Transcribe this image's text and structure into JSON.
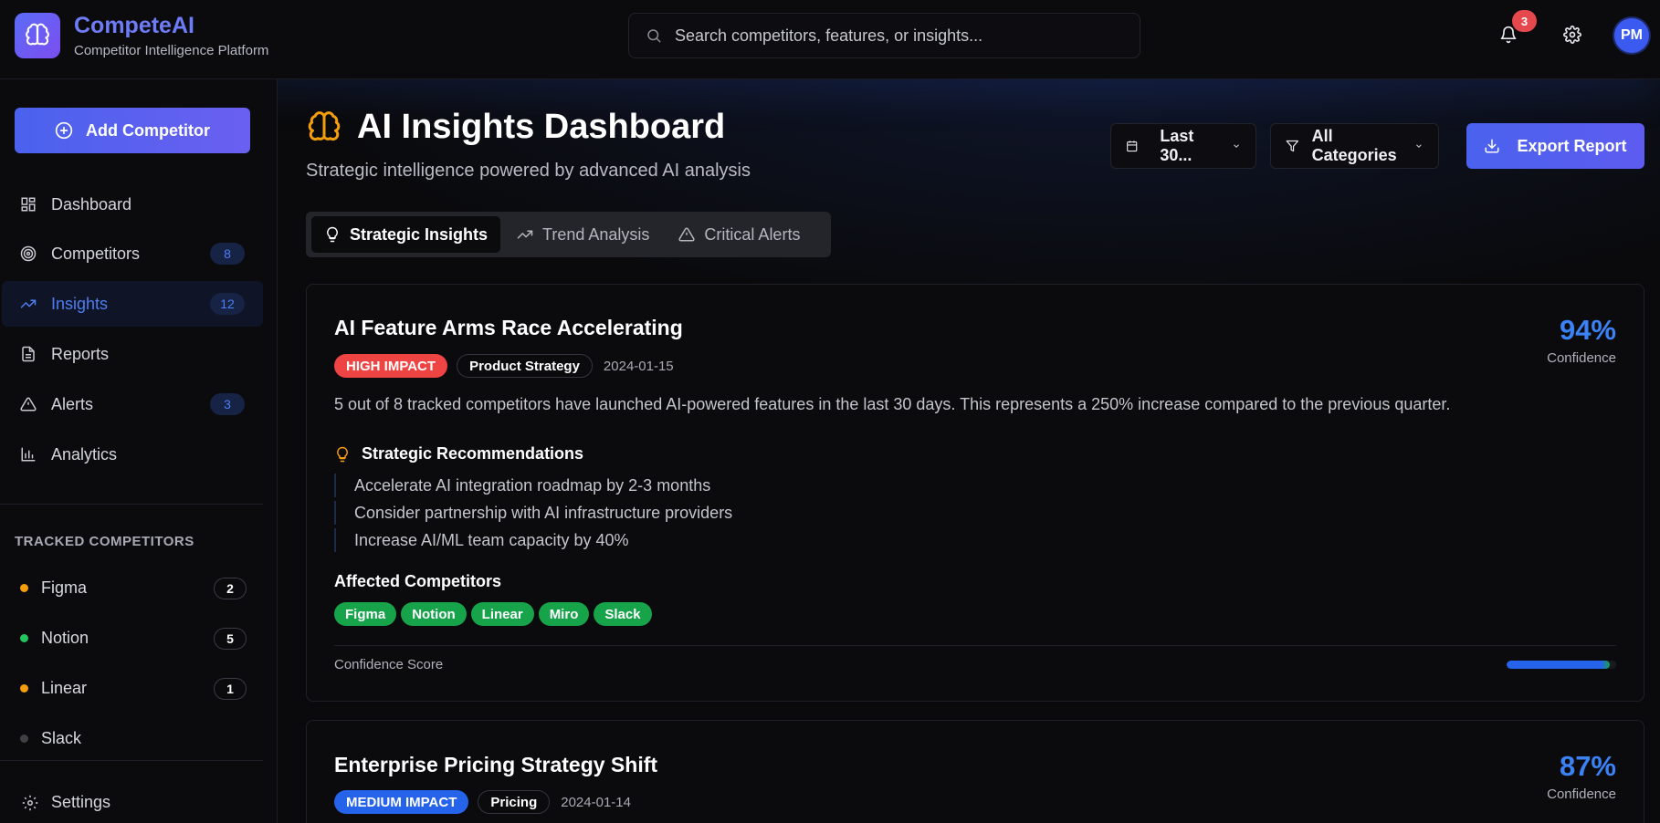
{
  "app": {
    "name": "CompeteAI",
    "tagline": "Competitor Intelligence Platform",
    "brand_color": "#6e7cf7"
  },
  "header": {
    "search_placeholder": "Search competitors, features, or insights...",
    "notification_count": "3",
    "avatar_initials": "PM"
  },
  "sidebar": {
    "add_button_label": "Add Competitor",
    "nav": [
      {
        "label": "Dashboard",
        "icon": "grid-icon",
        "badge": ""
      },
      {
        "label": "Competitors",
        "icon": "target-icon",
        "badge": "8"
      },
      {
        "label": "Insights",
        "icon": "trending-up-icon",
        "badge": "12",
        "active": true
      },
      {
        "label": "Reports",
        "icon": "file-text-icon",
        "badge": ""
      },
      {
        "label": "Alerts",
        "icon": "alert-triangle-icon",
        "badge": "3"
      },
      {
        "label": "Analytics",
        "icon": "bar-chart-icon",
        "badge": ""
      }
    ],
    "section_title": "TRACKED COMPETITORS",
    "competitors": [
      {
        "name": "Figma",
        "count": "2",
        "dot_color": "#f59e0b"
      },
      {
        "name": "Notion",
        "count": "5",
        "dot_color": "#22c55e"
      },
      {
        "name": "Linear",
        "count": "1",
        "dot_color": "#f59e0b"
      },
      {
        "name": "Slack",
        "count": "",
        "dot_color": "#3f3f46"
      }
    ],
    "settings_label": "Settings"
  },
  "main": {
    "title": "AI Insights Dashboard",
    "subtitle": "Strategic intelligence powered by advanced AI analysis",
    "date_filter": "Last 30...",
    "category_filter": "All Categories",
    "export_label": "Export Report",
    "tabs": [
      {
        "label": "Strategic Insights",
        "icon": "lightbulb-icon",
        "active": true
      },
      {
        "label": "Trend Analysis",
        "icon": "trending-up-icon"
      },
      {
        "label": "Critical Alerts",
        "icon": "alert-triangle-icon"
      }
    ]
  },
  "insights": [
    {
      "title": "AI Feature Arms Race Accelerating",
      "impact": "HIGH IMPACT",
      "impact_color": "#ef4444",
      "category": "Product Strategy",
      "date": "2024-01-15",
      "confidence": "94%",
      "confidence_label": "Confidence",
      "confidence_value": 0.94,
      "description": "5 out of 8 tracked competitors have launched AI-powered features in the last 30 days. This represents a 250% increase compared to the previous quarter.",
      "recommendations_title": "Strategic Recommendations",
      "recommendations": [
        "Accelerate AI integration roadmap by 2-3 months",
        "Consider partnership with AI infrastructure providers",
        "Increase AI/ML team capacity by 40%"
      ],
      "affected_title": "Affected Competitors",
      "affected": [
        "Figma",
        "Notion",
        "Linear",
        "Miro",
        "Slack"
      ],
      "score_label": "Confidence Score"
    },
    {
      "title": "Enterprise Pricing Strategy Shift",
      "impact": "MEDIUM IMPACT",
      "impact_color": "#2563eb",
      "category": "Pricing",
      "date": "2024-01-14",
      "confidence": "87%",
      "confidence_label": "Confidence"
    }
  ]
}
